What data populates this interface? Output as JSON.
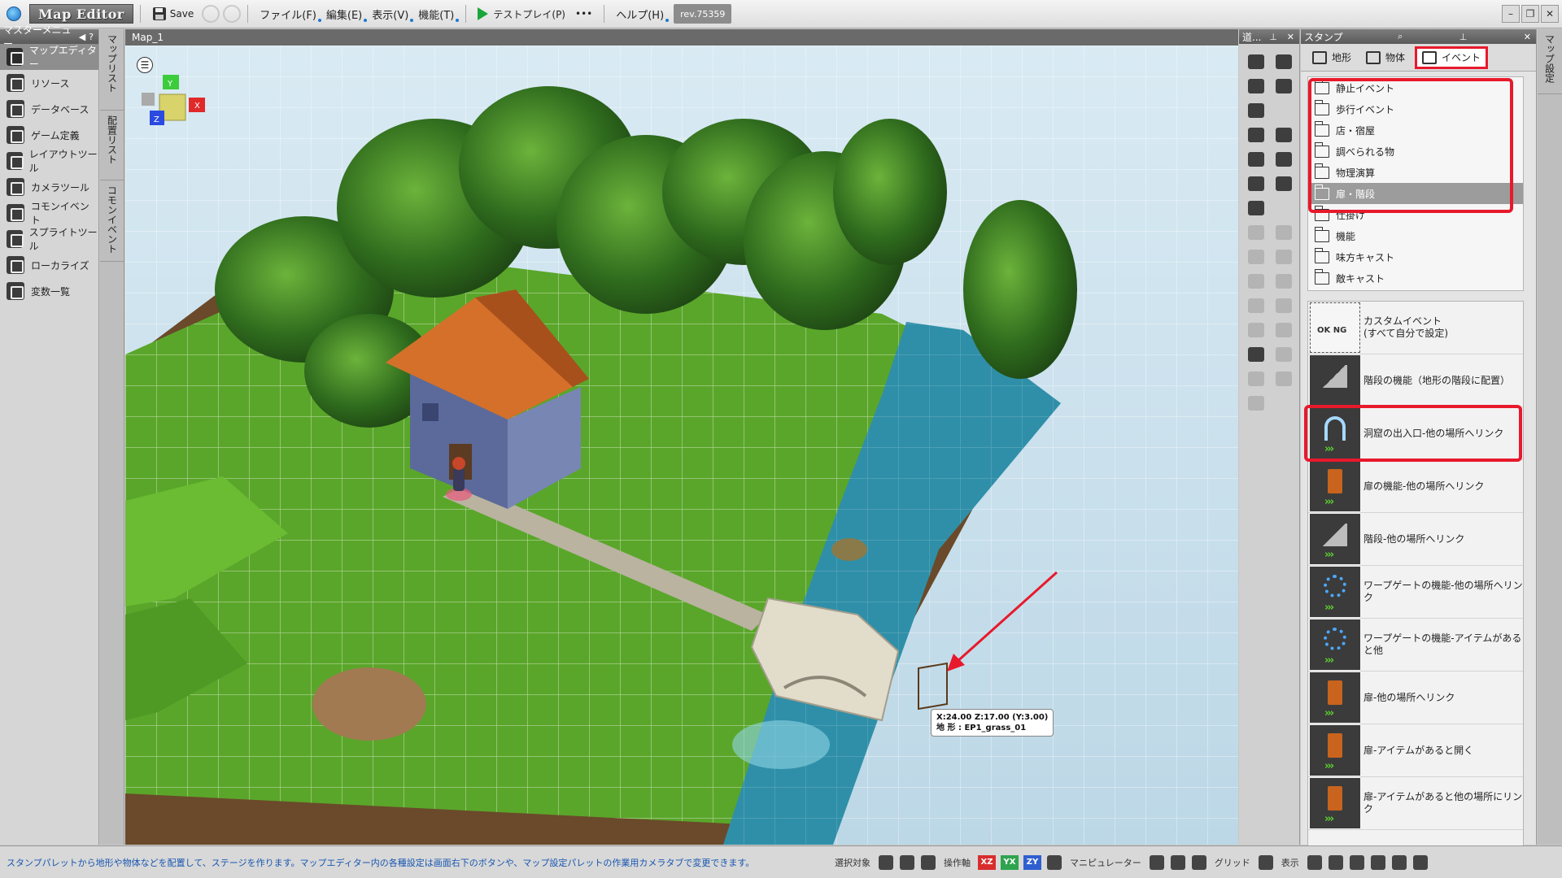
{
  "app": {
    "title": "Map Editor",
    "save_label": "Save",
    "menus": [
      "ファイル(F)",
      "編集(E)",
      "表示(V)",
      "機能(T)"
    ],
    "testplay_label": "テストプレイ(P)",
    "more_label": "•••",
    "help_label": "ヘルプ(H)",
    "revision": "rev.75359"
  },
  "master_menu": {
    "title": "マスターメニュー",
    "items": [
      {
        "label": "マップエディター",
        "active": true
      },
      {
        "label": "リソース",
        "active": false
      },
      {
        "label": "データベース",
        "active": false
      },
      {
        "label": "ゲーム定義",
        "active": false
      },
      {
        "label": "レイアウトツール",
        "active": false
      },
      {
        "label": "カメラツール",
        "active": false
      },
      {
        "label": "コモンイベント",
        "active": false
      },
      {
        "label": "スプライトツール",
        "active": false
      },
      {
        "label": "ローカライズ",
        "active": false
      },
      {
        "label": "変数一覧",
        "active": false
      }
    ]
  },
  "left_vtabs": [
    "マップリスト",
    "配置リスト",
    "コモンイベント"
  ],
  "right_vtabs": [
    "マップ設定"
  ],
  "viewport": {
    "tab_label": "Map_1",
    "coord_line1": "X:24.00 Z:17.00 (Y:3.00)",
    "coord_line2": "地 形 : EP1_grass_01",
    "gizmo_axes": {
      "y": "Y",
      "z": "Z",
      "x": "X"
    }
  },
  "tools_panel": {
    "title": "道..."
  },
  "stamp": {
    "title": "スタンプ",
    "tabs": [
      {
        "label": "地形",
        "active": false
      },
      {
        "label": "物体",
        "active": false
      },
      {
        "label": "イベント",
        "active": true
      }
    ],
    "categories": [
      {
        "label": "静止イベント",
        "selected": false
      },
      {
        "label": "歩行イベント",
        "selected": false
      },
      {
        "label": "店・宿屋",
        "selected": false
      },
      {
        "label": "調べられる物",
        "selected": false
      },
      {
        "label": "物理演算",
        "selected": false
      },
      {
        "label": "扉・階段",
        "selected": true
      },
      {
        "label": "仕掛け",
        "selected": false
      },
      {
        "label": "機能",
        "selected": false
      },
      {
        "label": "味方キャスト",
        "selected": false
      },
      {
        "label": "敵キャスト",
        "selected": false
      }
    ],
    "events": [
      {
        "label": "カスタムイベント",
        "sub": "(すべて自分で設定)",
        "kind": "custom"
      },
      {
        "label": "階段の機能（地形の階段に配置）",
        "sub": "",
        "kind": "stairs"
      },
      {
        "label": "洞窟の出入口-他の場所へリンク",
        "sub": "",
        "kind": "cave"
      },
      {
        "label": "扉の機能-他の場所へリンク",
        "sub": "",
        "kind": "door"
      },
      {
        "label": "階段-他の場所へリンク",
        "sub": "",
        "kind": "stairs"
      },
      {
        "label": "ワープゲートの機能-他の場所へリンク",
        "sub": "",
        "kind": "warp"
      },
      {
        "label": "ワープゲートの機能-アイテムがあると他",
        "sub": "",
        "kind": "warp"
      },
      {
        "label": "扉-他の場所へリンク",
        "sub": "",
        "kind": "door"
      },
      {
        "label": "扉-アイテムがあると開く",
        "sub": "",
        "kind": "door"
      },
      {
        "label": "扉-アイテムがあると他の場所にリンク",
        "sub": "",
        "kind": "door"
      }
    ],
    "custom_ok": "OK",
    "custom_ng": "NG"
  },
  "statusbar": {
    "message": "スタンプパレットから地形や物体などを配置して、ステージを作ります。マップエディター内の各種設定は画面右下のボタンや、マップ設定パレットの作業用カメラタブで変更できます。",
    "select_label": "選択対象",
    "axis_label": "操作軸",
    "axes": [
      "XZ",
      "YX",
      "ZY"
    ],
    "manipulator_label": "マニピュレーター",
    "grid_label": "グリッド",
    "display_label": "表示"
  },
  "colors": {
    "highlight": "#e8192c",
    "water": "#2f8fa8",
    "grass": "#5aa62a",
    "axis_xz": "#d92d2d",
    "axis_yx": "#2ea44f",
    "axis_zy": "#2f5fd0"
  }
}
